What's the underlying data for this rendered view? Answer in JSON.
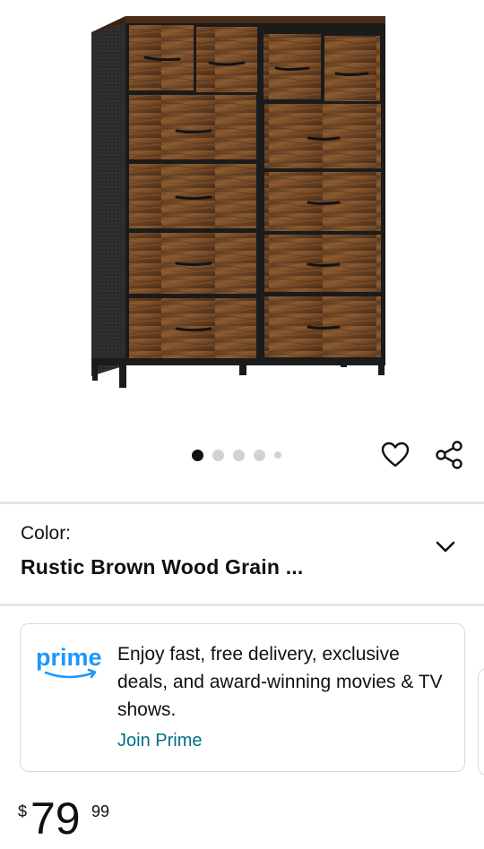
{
  "gallery": {
    "image_alt": "Rustic brown wood grain dresser with 12 fabric drawers and black metal frame",
    "dots": [
      {
        "state": "active"
      },
      {
        "state": "inactive"
      },
      {
        "state": "inactive"
      },
      {
        "state": "inactive"
      },
      {
        "state": "inactive-small"
      }
    ]
  },
  "actions": {
    "wishlist_icon": "heart-outline-icon",
    "share_icon": "share-icon"
  },
  "variation": {
    "label": "Color:",
    "value": "Rustic Brown Wood Grain ...",
    "icon": "chevron-down-icon"
  },
  "prime": {
    "logo_text": "prime",
    "description": "Enjoy fast, free delivery, exclusive deals, and award-winning movies & TV shows.",
    "link": "Join Prime",
    "brand_color": "#1a98ff",
    "link_color": "#007185"
  },
  "price": {
    "symbol": "$",
    "whole": "79",
    "fraction": "99"
  }
}
